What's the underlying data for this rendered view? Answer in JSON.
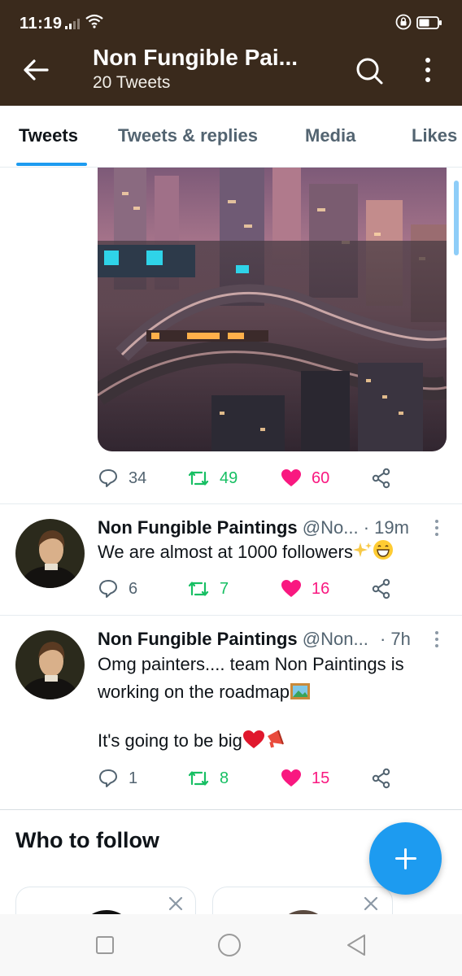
{
  "status_bar": {
    "time": "11:19"
  },
  "header": {
    "title": "Non Fungible Pai...",
    "subtitle": "20 Tweets",
    "back_icon": "arrow-left-icon",
    "search_icon": "search-icon",
    "more_icon": "more-vertical-icon"
  },
  "tabs": [
    {
      "label": "Tweets",
      "active": true
    },
    {
      "label": "Tweets & replies",
      "active": false
    },
    {
      "label": "Media",
      "active": false
    },
    {
      "label": "Likes",
      "active": false
    }
  ],
  "top_tweet": {
    "media_description_icon": "image",
    "replies": "34",
    "retweets": "49",
    "likes": "60"
  },
  "tweets": [
    {
      "name": "Non Fungible Paintings",
      "handle": "@No...",
      "time": "· 19m",
      "text": "We are almost at 1000 followers",
      "replies": "6",
      "retweets": "7",
      "likes": "16"
    },
    {
      "name": "Non Fungible Paintings",
      "handle": "@Non...",
      "time": "· 7h",
      "text_line1": "Omg painters.... team Non Paintings is",
      "text_line2": "working on the roadmap",
      "text_line3": "It's going to be big",
      "replies": "1",
      "retweets": "8",
      "likes": "15"
    }
  ],
  "who_to_follow": {
    "title": "Who to follow"
  },
  "colors": {
    "header_bg": "#3a2a1c",
    "accent": "#1d9bf0",
    "retweet": "#17bf63",
    "like": "#f91880",
    "muted": "#536471"
  }
}
